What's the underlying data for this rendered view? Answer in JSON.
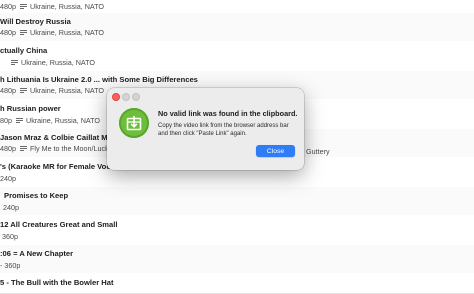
{
  "rows": [
    {
      "meta": "480p",
      "tags": "Ukraine, Russia, NATO"
    },
    {
      "title": "Will Destroy Russia",
      "meta": "480p",
      "tags": "Ukraine, Russia, NATO"
    },
    {
      "title": "ctually China",
      "tags": "Ukraine, Russia, NATO"
    },
    {
      "title": "h Lithuania Is Ukraine 2.0 ... with Some Big Differences",
      "meta": "480p",
      "tags": "Ukraine, Russia, NATO"
    },
    {
      "title": "h Russian power",
      "meta": "80p",
      "tags": "Ukraine, Russia, NATO"
    },
    {
      "title": "Jason Mraz & Colbie Caillat MA",
      "meta": "480p",
      "tags": "Fly Me to the Moon/Lucky",
      "tail": "Guttery"
    },
    {
      "title": "'s (Karaoke MR for Female Vocal",
      "meta": "240p"
    },
    {
      "title": "Promises to Keep",
      "meta": "240p"
    },
    {
      "title": "12  All Creatures Great and Small",
      "meta": "360p"
    },
    {
      "title": ":06 = A New Chapter",
      "meta": "- 360p"
    },
    {
      "title": "5 - The Bull with the Bowler Hat"
    }
  ],
  "dialog": {
    "title": "No valid link was found in the clipboard.",
    "body": "Copy the video link from the browser address bar and then click \"Paste Link\" again.",
    "button": "Close",
    "accent": "#2e7cf6",
    "icon": "download-box-icon"
  }
}
